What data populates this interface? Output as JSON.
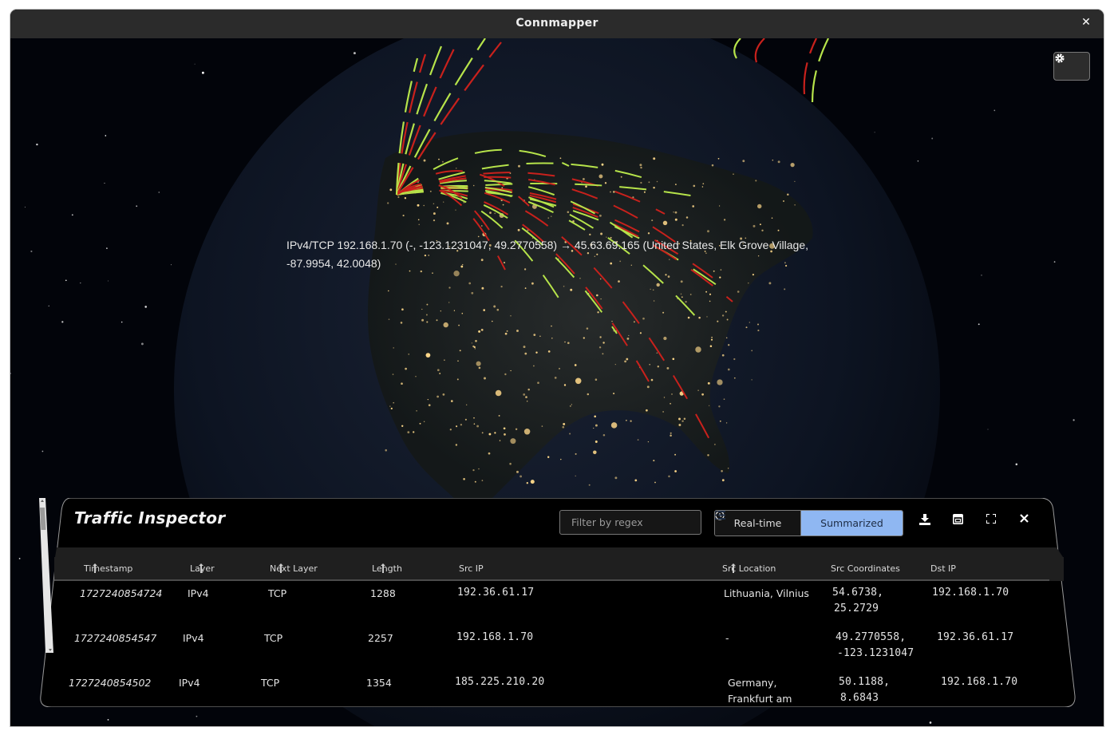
{
  "window": {
    "title": "Connmapper"
  },
  "overlay": {
    "tooltip": "IPv4/TCP 192.168.1.70 (-, -123.1231047, 49.2770558) → 45.63.69.165 (United States, Elk Grove Village, -87.9954, 42.0048)"
  },
  "inspector": {
    "title": "Traffic Inspector",
    "filter_placeholder": "Filter by regex",
    "modes": {
      "realtime": "Real-time",
      "summarized": "Summarized",
      "active": "summarized"
    },
    "columns": [
      "Timestamp",
      "Layer",
      "Next Layer",
      "Length",
      "Src IP",
      "Src Location",
      "Src Coordinates",
      "Dst IP"
    ],
    "rows": [
      {
        "timestamp": "1727240854724",
        "layer": "IPv4",
        "next_layer": "TCP",
        "length": "1288",
        "src_ip": "192.36.61.17",
        "src_location": "Lithuania, Vilnius",
        "src_coord_1": "54.6738,",
        "src_coord_2": "25.2729",
        "dst_ip": "192.168.1.70"
      },
      {
        "timestamp": "1727240854547",
        "layer": "IPv4",
        "next_layer": "TCP",
        "length": "2257",
        "src_ip": "192.168.1.70",
        "src_location": "-",
        "src_coord_1": "49.2770558,",
        "src_coord_2": "-123.1231047",
        "dst_ip": "192.36.61.17"
      },
      {
        "timestamp": "1727240854502",
        "layer": "IPv4",
        "next_layer": "TCP",
        "length": "1354",
        "src_ip": "185.225.210.20",
        "src_location_1": "Germany,",
        "src_location_2": "Frankfurt am",
        "src_coord_1": "50.1188,",
        "src_coord_2": "8.6843",
        "dst_ip": "192.168.1.70"
      }
    ]
  },
  "colors": {
    "arc_green": "#b6e34a",
    "arc_red": "#c8211c",
    "city_light": "#ffd98a",
    "active_mode": "#8fb7f2"
  }
}
